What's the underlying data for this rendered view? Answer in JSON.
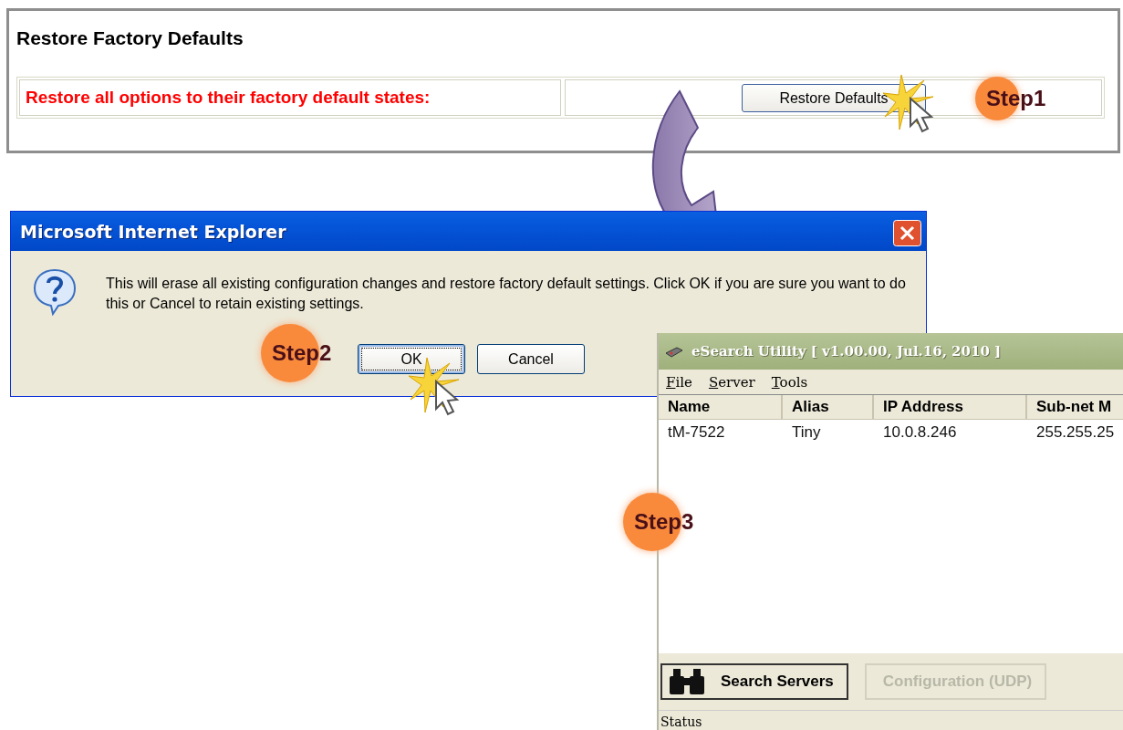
{
  "web_panel": {
    "title": "Restore Factory Defaults",
    "label": "Restore all options to their factory default states:",
    "button": "Restore Defaults"
  },
  "steps": [
    "Step1",
    "Step2",
    "Step3"
  ],
  "dialog": {
    "title": "Microsoft Internet Explorer",
    "message": "This will erase all existing configuration changes and restore factory default settings. Click OK if you are sure you want to do this or Cancel to retain existing settings.",
    "buttons": [
      {
        "label": "OK",
        "selected": true
      },
      {
        "label": "Cancel",
        "selected": false
      }
    ]
  },
  "esearch": {
    "title": "eSearch Utility [ v1.00.00, Jul.16, 2010 ]",
    "menu": [
      "File",
      "Server",
      "Tools"
    ],
    "columns": [
      "Name",
      "Alias",
      "IP Address",
      "Sub-net M"
    ],
    "rows": [
      [
        "tM-7522",
        "Tiny",
        "10.0.8.246",
        "255.255.25"
      ]
    ],
    "buttons": [
      {
        "label": "Search Servers",
        "disabled": false
      },
      {
        "label": "Configuration (UDP)",
        "disabled": true
      }
    ],
    "status": "Status"
  }
}
